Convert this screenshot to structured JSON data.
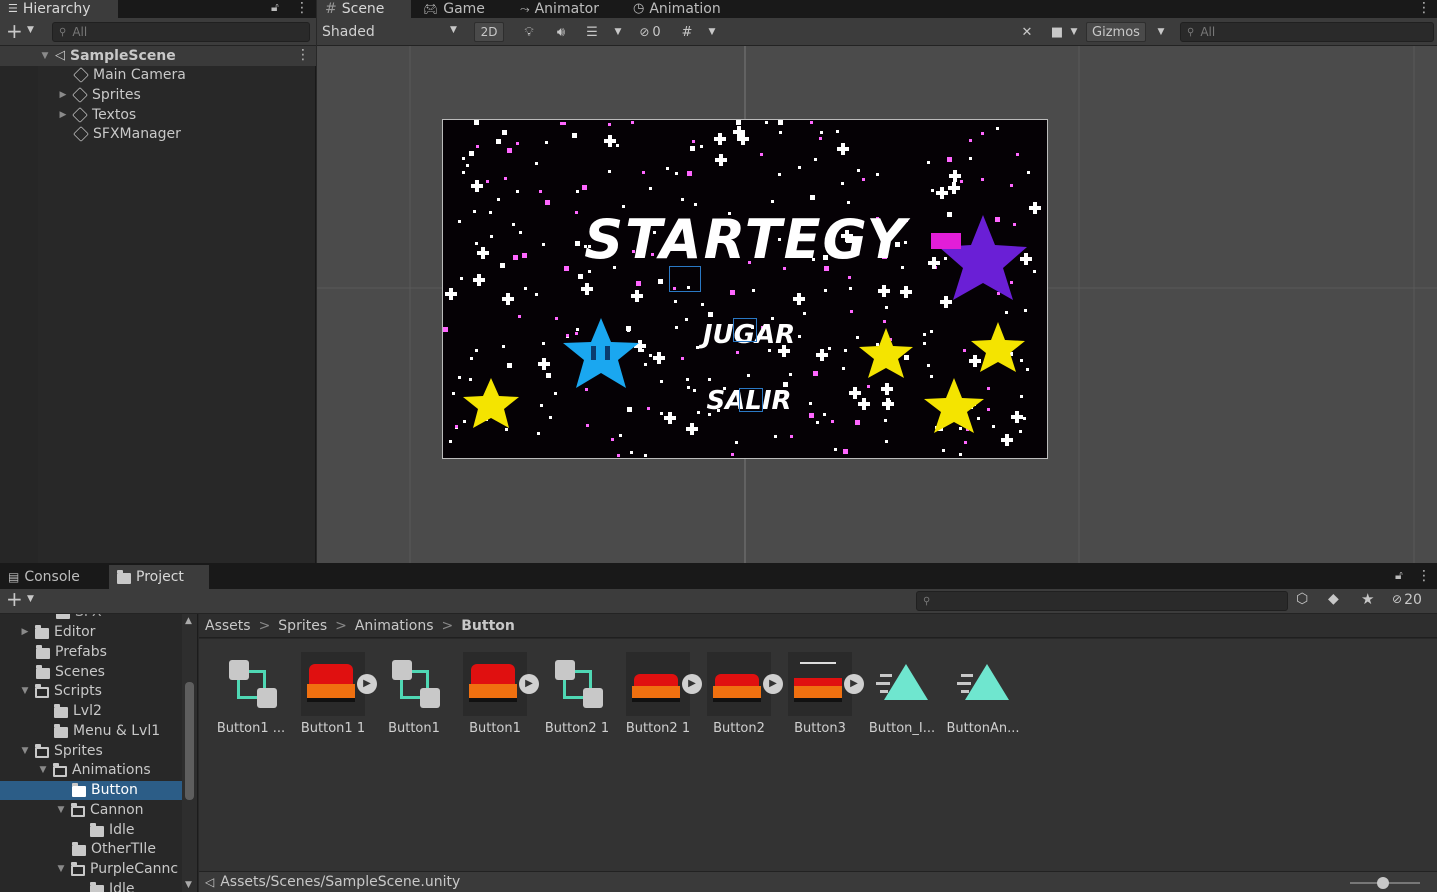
{
  "hierarchy": {
    "tab_label": "Hierarchy",
    "search_placeholder": "All",
    "scene": "SampleScene",
    "items": [
      "Main Camera",
      "Sprites",
      "Textos",
      "SFXManager"
    ]
  },
  "scene_view": {
    "tabs": [
      "Scene",
      "Game",
      "Animator",
      "Animation"
    ],
    "shading_mode": "Shaded",
    "toggle_2d": "2D",
    "hidden_count": "0",
    "gizmos_label": "Gizmos",
    "search_placeholder": "All"
  },
  "game_canvas": {
    "title": "STARTEGY",
    "buttons": [
      "JUGAR",
      "SALIR"
    ]
  },
  "bottom": {
    "tabs": [
      "Console",
      "Project"
    ],
    "hidden_count": "20"
  },
  "project_tree": {
    "partial_top": "SFX",
    "items": [
      "Editor",
      "Prefabs",
      "Scenes",
      "Scripts",
      "Lvl2",
      "Menu & Lvl1",
      "Sprites",
      "Animations",
      "Button",
      "Cannon",
      "Idle",
      "OtherTIle",
      "PurpleCannc",
      "Idle"
    ]
  },
  "breadcrumb": [
    "Assets",
    "Sprites",
    "Animations",
    "Button"
  ],
  "assets": [
    "Button1 ...",
    "Button1 1",
    "Button1",
    "Button1",
    "Button2 1",
    "Button2 1",
    "Button2",
    "Button3",
    "Button_I...",
    "ButtonAn..."
  ],
  "status_path": "Assets/Scenes/SampleScene.unity",
  "colors": {
    "selection": "#2c5d87",
    "panel": "#282828",
    "toolbar": "#3c3c3c",
    "tab_bar": "#191919"
  }
}
